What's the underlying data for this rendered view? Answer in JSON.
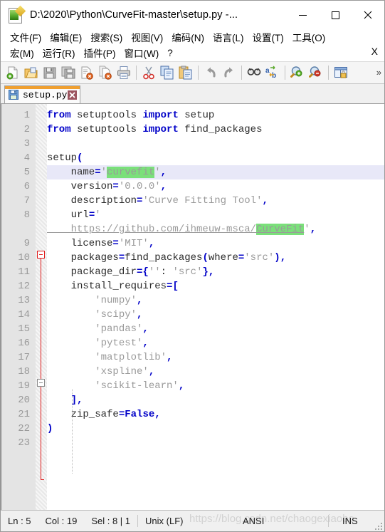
{
  "window": {
    "title": "D:\\2020\\Python\\CurveFit-master\\setup.py -...",
    "icon": "notepad-plus-plus-icon",
    "minimize": "—",
    "maximize": "☐",
    "close": "✕"
  },
  "menubar": {
    "row1": [
      {
        "label": "文件(F)",
        "mnemonic": "F"
      },
      {
        "label": "编辑(E)",
        "mnemonic": "E"
      },
      {
        "label": "搜索(S)",
        "mnemonic": "S"
      },
      {
        "label": "视图(V)",
        "mnemonic": "V"
      },
      {
        "label": "编码(N)",
        "mnemonic": "N"
      },
      {
        "label": "语言(L)",
        "mnemonic": "L"
      },
      {
        "label": "设置(T)",
        "mnemonic": "T"
      },
      {
        "label": "工具(O)",
        "mnemonic": "O"
      }
    ],
    "row2": [
      {
        "label": "宏(M)",
        "mnemonic": "M"
      },
      {
        "label": "运行(R)",
        "mnemonic": "R"
      },
      {
        "label": "插件(P)",
        "mnemonic": "P"
      },
      {
        "label": "窗口(W)",
        "mnemonic": "W"
      },
      {
        "label": "?",
        "mnemonic": ""
      }
    ],
    "close_doc": "X"
  },
  "toolbar": {
    "buttons": [
      "new-file-icon",
      "open-file-icon",
      "save-icon",
      "save-all-icon",
      "close-file-icon",
      "close-all-files-icon",
      "print-icon",
      "cut-icon",
      "copy-icon",
      "paste-icon",
      "undo-icon",
      "redo-icon",
      "find-icon",
      "replace-icon",
      "zoom-in-icon",
      "zoom-out-icon",
      "sync-lock-icon"
    ],
    "overflow": "»"
  },
  "tabs": [
    {
      "label": "setup.py",
      "icon": "saved-file-icon",
      "close": "✕",
      "active": true
    }
  ],
  "editor": {
    "line_count": 23,
    "lines": [
      {
        "n": 1,
        "tokens": [
          {
            "t": "from",
            "c": "kw"
          },
          {
            "t": " setuptools ",
            "c": ""
          },
          {
            "t": "import",
            "c": "kw"
          },
          {
            "t": " setup",
            "c": ""
          }
        ]
      },
      {
        "n": 2,
        "tokens": [
          {
            "t": "from",
            "c": "kw"
          },
          {
            "t": " setuptools ",
            "c": ""
          },
          {
            "t": "import",
            "c": "kw"
          },
          {
            "t": " find_packages",
            "c": ""
          }
        ]
      },
      {
        "n": 3,
        "tokens": []
      },
      {
        "n": 4,
        "tokens": [
          {
            "t": "setup",
            "c": ""
          },
          {
            "t": "(",
            "c": "op"
          }
        ]
      },
      {
        "n": 5,
        "tokens": [
          {
            "t": "    name",
            "c": ""
          },
          {
            "t": "=",
            "c": "op"
          },
          {
            "t": "'",
            "c": "str"
          },
          {
            "t": "curvefit",
            "c": "str sel"
          },
          {
            "t": "'",
            "c": "str"
          },
          {
            "t": ",",
            "c": "op"
          }
        ],
        "active": true
      },
      {
        "n": 6,
        "tokens": [
          {
            "t": "    version",
            "c": ""
          },
          {
            "t": "=",
            "c": "op"
          },
          {
            "t": "'0.0.0'",
            "c": "str"
          },
          {
            "t": ",",
            "c": "op"
          }
        ]
      },
      {
        "n": 7,
        "tokens": [
          {
            "t": "    description",
            "c": ""
          },
          {
            "t": "=",
            "c": "op"
          },
          {
            "t": "'Curve Fitting Tool'",
            "c": "str"
          },
          {
            "t": ",",
            "c": "op"
          }
        ]
      },
      {
        "n": 8,
        "tokens": [
          {
            "t": "    url",
            "c": ""
          },
          {
            "t": "=",
            "c": "op"
          },
          {
            "t": "'",
            "c": "str"
          }
        ]
      },
      {
        "n": "",
        "tokens": [
          {
            "t": "    https://github.com/ihmeuw-msca/",
            "c": "url"
          },
          {
            "t": "CurveFit",
            "c": "url sel"
          },
          {
            "t": "'",
            "c": "str"
          },
          {
            "t": ",",
            "c": "op"
          }
        ],
        "wrapped": true
      },
      {
        "n": 9,
        "tokens": [
          {
            "t": "    license",
            "c": ""
          },
          {
            "t": "=",
            "c": "op"
          },
          {
            "t": "'MIT'",
            "c": "str"
          },
          {
            "t": ",",
            "c": "op"
          }
        ]
      },
      {
        "n": 10,
        "tokens": [
          {
            "t": "    packages",
            "c": ""
          },
          {
            "t": "=",
            "c": "op"
          },
          {
            "t": "find_packages",
            "c": ""
          },
          {
            "t": "(",
            "c": "op"
          },
          {
            "t": "where",
            "c": ""
          },
          {
            "t": "=",
            "c": "op"
          },
          {
            "t": "'src'",
            "c": "str"
          },
          {
            "t": ")",
            "c": "op"
          },
          {
            "t": ",",
            "c": "op"
          }
        ]
      },
      {
        "n": 11,
        "tokens": [
          {
            "t": "    package_dir",
            "c": ""
          },
          {
            "t": "=",
            "c": "op"
          },
          {
            "t": "{",
            "c": "op"
          },
          {
            "t": "''",
            "c": "str"
          },
          {
            "t": ": ",
            "c": ""
          },
          {
            "t": "'src'",
            "c": "str"
          },
          {
            "t": "}",
            "c": "op"
          },
          {
            "t": ",",
            "c": "op"
          }
        ]
      },
      {
        "n": 12,
        "tokens": [
          {
            "t": "    install_requires",
            "c": ""
          },
          {
            "t": "=",
            "c": "op"
          },
          {
            "t": "[",
            "c": "op"
          }
        ]
      },
      {
        "n": 13,
        "tokens": [
          {
            "t": "        'numpy'",
            "c": "str"
          },
          {
            "t": ",",
            "c": "op"
          }
        ]
      },
      {
        "n": 14,
        "tokens": [
          {
            "t": "        'scipy'",
            "c": "str"
          },
          {
            "t": ",",
            "c": "op"
          }
        ]
      },
      {
        "n": 15,
        "tokens": [
          {
            "t": "        'pandas'",
            "c": "str"
          },
          {
            "t": ",",
            "c": "op"
          }
        ]
      },
      {
        "n": 16,
        "tokens": [
          {
            "t": "        'pytest'",
            "c": "str"
          },
          {
            "t": ",",
            "c": "op"
          }
        ]
      },
      {
        "n": 17,
        "tokens": [
          {
            "t": "        'matplotlib'",
            "c": "str"
          },
          {
            "t": ",",
            "c": "op"
          }
        ]
      },
      {
        "n": 18,
        "tokens": [
          {
            "t": "        'xspline'",
            "c": "str"
          },
          {
            "t": ",",
            "c": "op"
          }
        ]
      },
      {
        "n": 19,
        "tokens": [
          {
            "t": "        'scikit-learn'",
            "c": "str"
          },
          {
            "t": ",",
            "c": "op"
          }
        ]
      },
      {
        "n": 20,
        "tokens": [
          {
            "t": "    ]",
            "c": "op"
          },
          {
            "t": ",",
            "c": "op"
          }
        ]
      },
      {
        "n": 21,
        "tokens": [
          {
            "t": "    zip_safe",
            "c": ""
          },
          {
            "t": "=",
            "c": "op"
          },
          {
            "t": "False",
            "c": "kw"
          },
          {
            "t": ",",
            "c": "op"
          }
        ]
      },
      {
        "n": 22,
        "tokens": [
          {
            "t": ")",
            "c": "op"
          }
        ]
      },
      {
        "n": 23,
        "tokens": []
      }
    ],
    "selection_text": "curvefit",
    "secondary_highlight": "CurveFit",
    "colors": {
      "keyword": "#0000c8",
      "string": "#9a9a9a",
      "selection": "#7ae07a",
      "current_line": "#e8e8f8",
      "fold_line": "#e01b1b",
      "gutter_bg": "#e4e4e4",
      "line_number": "#9a9a9a",
      "tab_accent": "#f0a030"
    }
  },
  "statusbar": {
    "ln": "Ln : 5",
    "col": "Col : 19",
    "sel": "Sel : 8 | 1",
    "eol": "Unix (LF)",
    "encoding": "ANSI",
    "mode": "INS",
    "watermark": "https://blog.csdn.net/chaogexiaobo"
  }
}
